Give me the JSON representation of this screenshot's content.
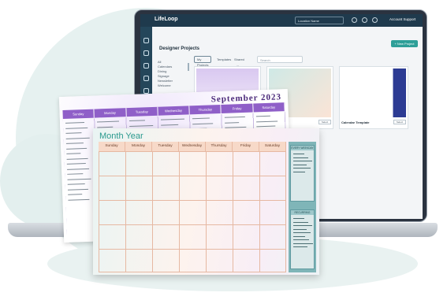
{
  "app": {
    "logo": "LifeLoop",
    "location": "Location Name",
    "user": "Account Support",
    "page_title": "Designer Projects",
    "new_project_label": "+ New Project",
    "filters": [
      "All",
      "Calendars",
      "Dining",
      "Signage",
      "Newsletter",
      "Welcome"
    ],
    "tabs": [
      "My Projects",
      "Templates",
      "Shared with Me"
    ],
    "search_placeholder": "Search"
  },
  "cards": [
    {
      "name": ""
    },
    {
      "name": "",
      "button": "Select"
    },
    {
      "name": "Calendar Template",
      "button": "Select"
    }
  ],
  "purple_calendar": {
    "month": "September 2023",
    "days": [
      "Sunday",
      "Monday",
      "Tuesday",
      "Wednesday",
      "Thursday",
      "Friday",
      "Saturday"
    ]
  },
  "main_calendar": {
    "title": "Month Year",
    "days": [
      "Sunday",
      "Monday",
      "Tuesday",
      "Wednesday",
      "Thursday",
      "Friday",
      "Saturday"
    ],
    "side_boxes": [
      "EVERY WEEKDAY",
      "RECURRING"
    ]
  },
  "colors": {
    "teal": "#2a9a8e",
    "purple": "#8f5fc8",
    "peach": "#f7d9c8",
    "navy": "#1f3a4d"
  }
}
